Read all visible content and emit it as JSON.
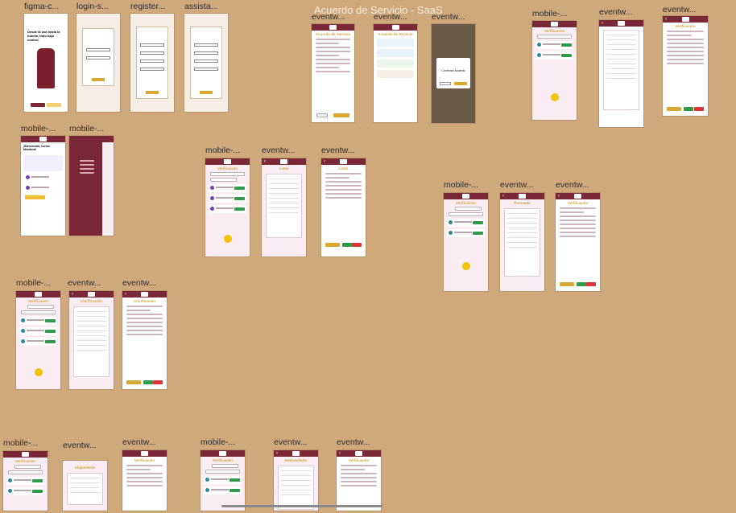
{
  "canvas_title": "Acuerdo de Servicio - SaaS",
  "frame_labels": [
    "figma-c...",
    "login-s...",
    "register...",
    "assista...",
    "eventw...",
    "eventw...",
    "eventw...",
    "mobile-...",
    "eventw...",
    "eventw...",
    "mobile-...",
    "mobile-...",
    "mobile-...",
    "eventw...",
    "eventw...",
    "mobile-...",
    "eventw...",
    "eventw...",
    "mobile-...",
    "eventw...",
    "eventw...",
    "mobile-...",
    "eventw...",
    "eventw...",
    "mobile-...",
    "eventw...",
    "eventw..."
  ],
  "screens": {
    "acuerdo_title": "Acuerdo de Servicio",
    "verificacion": "Verificación",
    "lotes": "Lotes",
    "prensado": "Prensado",
    "clarificacion": "Clarificación",
    "alojamiento": "Alojamiento",
    "embotellado": "Embotellado",
    "confirmar": "Confirmar Acuerdo",
    "welcome": "¡Bienvenido, Carlos Mendoza!",
    "hero_text": "Desde la uva hasta la botella, todo bajo control."
  },
  "colors": {
    "canvas": "#cfa97b",
    "brand": "#7a2837",
    "accent": "#d0a73b",
    "success": "#2f9b4a",
    "highlight": "#f4c20d"
  }
}
